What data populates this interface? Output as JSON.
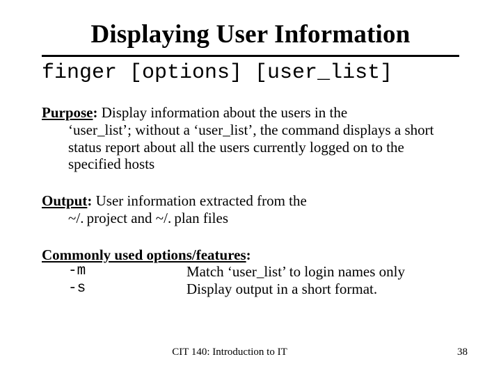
{
  "title": "Displaying User Information",
  "command": "finger [options] [user_list]",
  "purpose": {
    "label": "Purpose",
    "text": " Display information about the users in the ‘user_list’; without a ‘user_list’, the command displays a short status report about all the users currently logged on to the specified hosts"
  },
  "output": {
    "label": "Output",
    "text": " User information extracted from the ~/. project and ~/. plan files"
  },
  "options": {
    "label": "Commonly used options/features",
    "rows": [
      {
        "flag": "-m",
        "desc": "Match ‘user_list’ to login names only"
      },
      {
        "flag": "-s",
        "desc": "Display output in a short format."
      }
    ]
  },
  "footer": {
    "course": "CIT 140: Introduction to IT",
    "page": "38"
  }
}
